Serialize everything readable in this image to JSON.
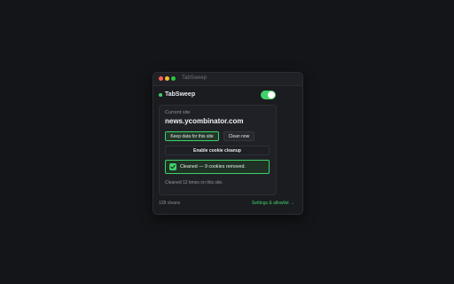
{
  "window": {
    "title": "TabSweep"
  },
  "header": {
    "app_name": "TabSweep",
    "enabled": true
  },
  "site": {
    "label": "Current site",
    "domain": "news.ycombinator.com"
  },
  "actions": {
    "keep_label": "Keep data for this site",
    "clean_label": "Clean now",
    "enable_label": "Enable cookie cleanup"
  },
  "notice": {
    "text": "Cleaned — 9 cookies removed."
  },
  "stats": {
    "site_cleaned": "Cleaned 12 times on this site."
  },
  "footer": {
    "count": "128 cleans",
    "settings_link": "Settings & allowlist →"
  },
  "colors": {
    "accent": "#3fd16a",
    "background": "#141518",
    "panel": "#1b1c20"
  }
}
